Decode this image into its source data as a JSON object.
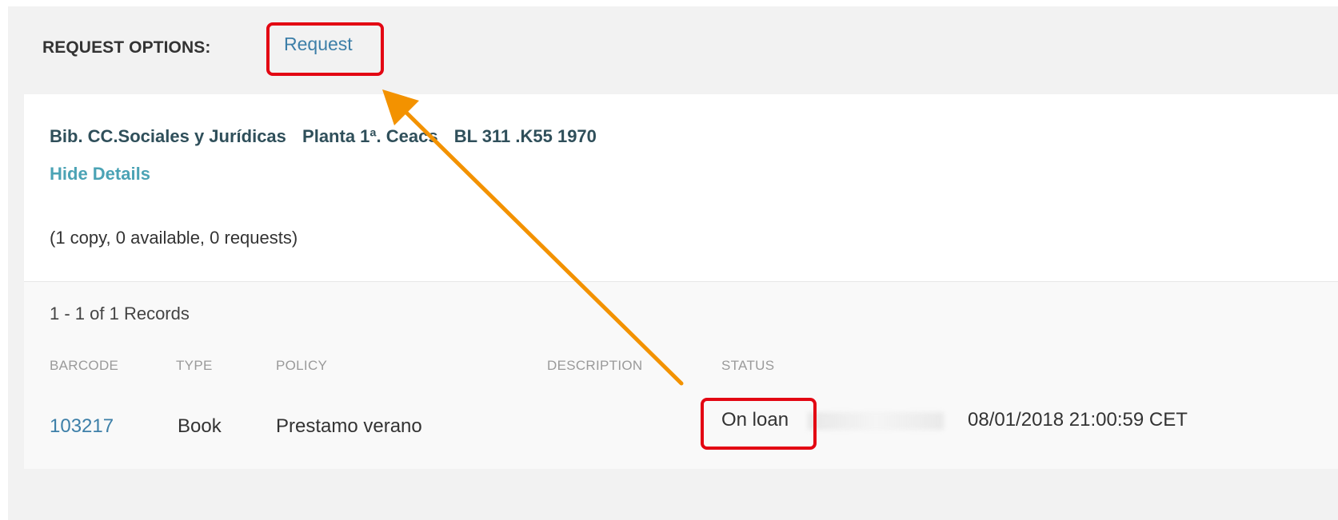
{
  "request_options": {
    "label": "REQUEST OPTIONS:",
    "request_link": "Request"
  },
  "holding": {
    "library": "Bib. CC.Sociales y Jurídicas",
    "location": "Planta 1ª. Ceacs",
    "call_number": "BL 311 .K55 1970",
    "hide_details": "Hide Details",
    "copies_summary": "(1 copy, 0 available, 0 requests)"
  },
  "records": {
    "summary": "1 - 1 of 1 Records",
    "columns": [
      "BARCODE",
      "TYPE",
      "POLICY",
      "DESCRIPTION",
      "STATUS"
    ],
    "rows": [
      {
        "barcode": "103217",
        "type": "Book",
        "policy": "Prestamo verano",
        "description": "",
        "status": "On loan",
        "due": "08/01/2018 21:00:59 CET"
      }
    ]
  },
  "annotation": {
    "highlight_color": "#e30613",
    "arrow_color": "#f39200"
  }
}
